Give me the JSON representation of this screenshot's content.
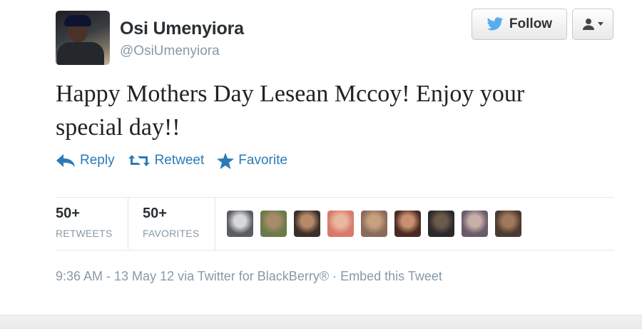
{
  "user": {
    "name": "Osi Umenyiora",
    "handle": "@OsiUmenyiora"
  },
  "buttons": {
    "follow_label": "Follow",
    "user_menu_icon": "person-dropdown-icon"
  },
  "tweet": {
    "text": "Happy Mothers Day Lesean Mccoy! Enjoy your special day!!"
  },
  "actions": {
    "reply": "Reply",
    "retweet": "Retweet",
    "favorite": "Favorite"
  },
  "stats": {
    "retweets_count": "50+",
    "retweets_label": "RETWEETS",
    "favorites_count": "50+",
    "favorites_label": "FAVORITES"
  },
  "favoriter_avatars": [
    {
      "color_a": "#5a5e63",
      "color_b": "#d8d8d8"
    },
    {
      "color_a": "#6b7a4a",
      "color_b": "#a88b6a"
    },
    {
      "color_a": "#3b2f2a",
      "color_b": "#b88a6a"
    },
    {
      "color_a": "#d87a6a",
      "color_b": "#e8b8a0"
    },
    {
      "color_a": "#8a6a5a",
      "color_b": "#c8a080"
    },
    {
      "color_a": "#4a2a20",
      "color_b": "#c89070"
    },
    {
      "color_a": "#2a2a2a",
      "color_b": "#6a5a4a"
    },
    {
      "color_a": "#6a5a6a",
      "color_b": "#c8b0a8"
    },
    {
      "color_a": "#4a3a30",
      "color_b": "#a0785a"
    }
  ],
  "meta": {
    "time": "9:36 AM - 13 May 12",
    "via": " via ",
    "client": "Twitter for BlackBerry®",
    "separator": " · ",
    "embed": "Embed this Tweet"
  },
  "colors": {
    "link_blue": "#2b7bb9",
    "twitter_bird": "#55acee",
    "muted": "#8899a6"
  }
}
